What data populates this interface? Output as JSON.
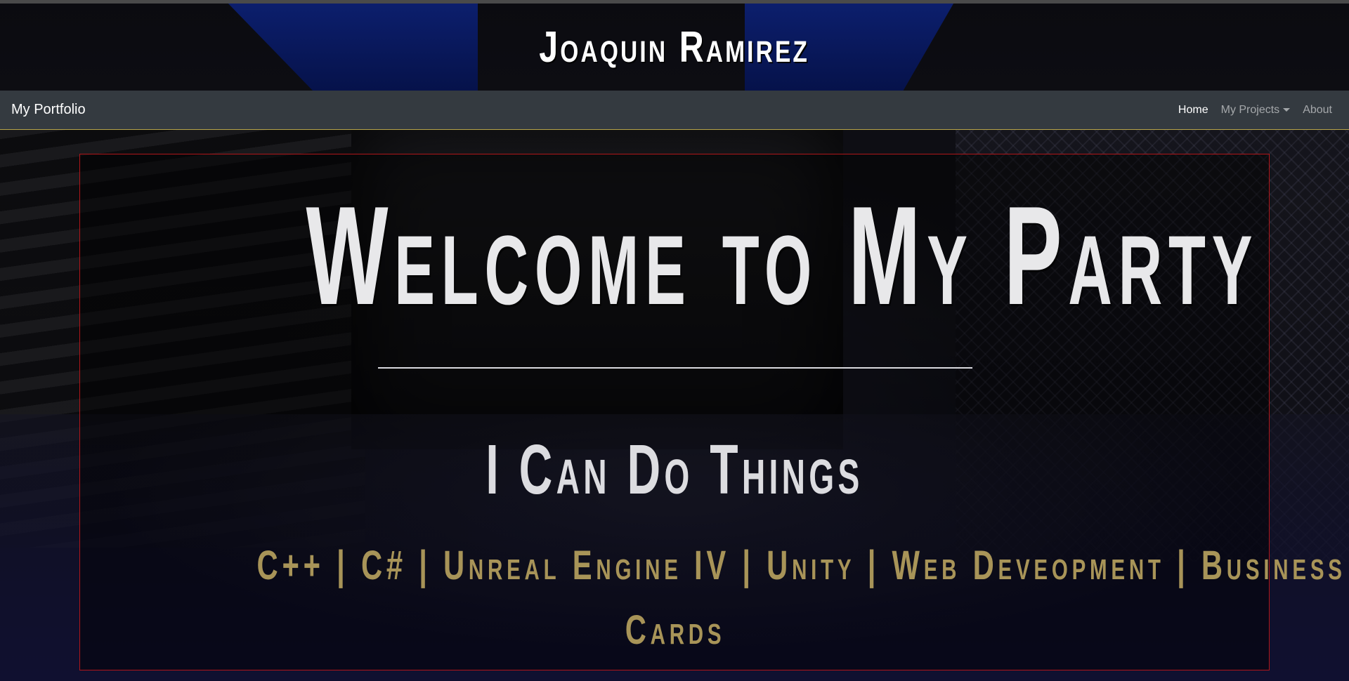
{
  "header": {
    "site_title": "Joaquin Ramirez"
  },
  "navbar": {
    "brand": "My Portfolio",
    "links": [
      {
        "label": "Home",
        "active": true
      },
      {
        "label": "My Projects",
        "dropdown": true
      },
      {
        "label": "About"
      }
    ]
  },
  "hero": {
    "title": "Welcome to My Party",
    "subtitle": "I Can Do Things",
    "skills_line_1": "C++  |  C#   |  Unreal Engine IV   |  Unity  |  Web Deveopment  |  Business",
    "skills_line_2": "Cards"
  },
  "colors": {
    "navbar_bg": "#343a40",
    "hero_border": "#b0161a",
    "skills_text": "#a89458",
    "title_text": "#e8e8ea"
  }
}
